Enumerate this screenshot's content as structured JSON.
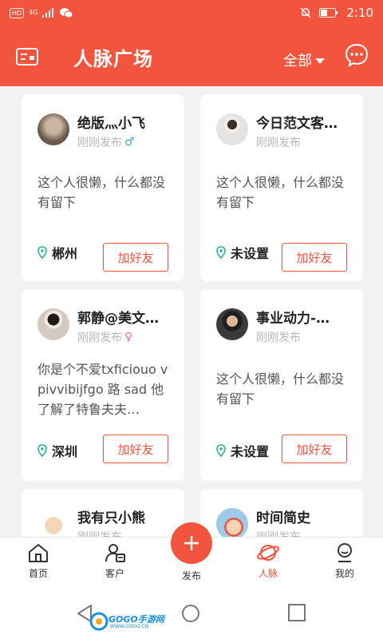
{
  "statusbar": {
    "hd": "HD",
    "network": "4G",
    "time": "2:10"
  },
  "header": {
    "title": "人脉广场",
    "filter_label": "全部",
    "icons": [
      "id-card-icon",
      "chat-bubble-icon"
    ]
  },
  "cards": [
    {
      "name": "绝版灬小飞",
      "time": "刚刚发布",
      "gender": "♂",
      "bio": "这个人很懒，什么都没有留下",
      "location": "郴州",
      "button": "加好友",
      "avatar_color": "#6b5a4c"
    },
    {
      "name": "今日范文客…",
      "time": "刚刚发布",
      "gender": "",
      "bio": "这个人很懒，什么都没有留下",
      "location": "未设置",
      "button": "加好友",
      "avatar_color": "#d8d8d8"
    },
    {
      "name": "郭静@美文…",
      "time": "刚刚发布",
      "gender": "♀",
      "bio": "你是个不爱txficiouo vpivvibijfgo 路 sad 他了解了特鲁夫夫…",
      "location": "深圳",
      "button": "加好友",
      "avatar_color": "#cfc6bd"
    },
    {
      "name": "事业动力-…",
      "time": "刚刚发布",
      "gender": "",
      "bio": "这个人很懒，什么都没有留下",
      "location": "未设置",
      "button": "加好友",
      "avatar_color": "#2b2b2b"
    },
    {
      "name": "我有只小熊",
      "time": "刚刚发布",
      "gender": "",
      "bio": "",
      "location": "",
      "button": "",
      "avatar_color": "#e9cba6"
    },
    {
      "name": "时间简史",
      "time": "刚刚发布",
      "gender": "",
      "bio": "",
      "location": "",
      "button": "",
      "avatar_color": "#9ec9e8"
    }
  ],
  "bottom_nav": {
    "items": [
      {
        "label": "首页",
        "icon": "home-icon"
      },
      {
        "label": "客户",
        "icon": "customer-icon"
      },
      {
        "label": "发布",
        "icon": "plus-icon"
      },
      {
        "label": "人脉",
        "icon": "planet-icon"
      },
      {
        "label": "我的",
        "icon": "profile-icon"
      }
    ]
  },
  "colors": {
    "accent": "#f2543d",
    "gender_male": "#3aa6e6",
    "gender_female": "#f06ab4",
    "location_pin": "#2bb39a"
  },
  "watermark": {
    "text": "GOGO手游网",
    "sub": "WWW.GOGO.CN"
  }
}
